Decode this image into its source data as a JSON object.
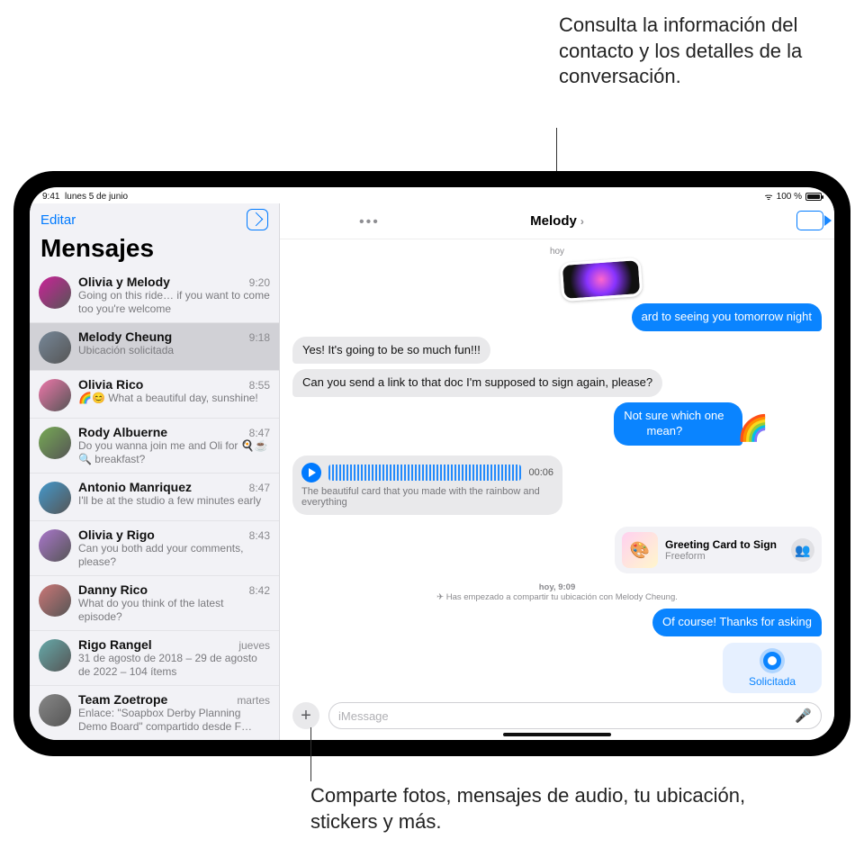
{
  "callouts": {
    "top": "Consulta la información del contacto y los detalles de la conversación.",
    "bottom": "Comparte fotos, mensajes de audio, tu ubicación, stickers y más."
  },
  "status": {
    "time": "9:41",
    "date": "lunes 5 de junio",
    "battery": "100 %",
    "battery_icon_label": "battery"
  },
  "sidebar": {
    "edit": "Editar",
    "title": "Mensajes",
    "conversations": [
      {
        "name": "Olivia y Melody",
        "time": "9:20",
        "preview": "Going on this ride… if you want to come too you're welcome"
      },
      {
        "name": "Melody Cheung",
        "time": "9:18",
        "preview": "Ubicación solicitada",
        "selected": true
      },
      {
        "name": "Olivia Rico",
        "time": "8:55",
        "preview": "🌈😊 What a beautiful day, sunshine!"
      },
      {
        "name": "Rody Albuerne",
        "time": "8:47",
        "preview": "Do you wanna join me and Oli for 🍳☕🔍 breakfast?"
      },
      {
        "name": "Antonio Manriquez",
        "time": "8:47",
        "preview": "I'll be at the studio a few minutes early"
      },
      {
        "name": "Olivia y Rigo",
        "time": "8:43",
        "preview": "Can you both add your comments, please?"
      },
      {
        "name": "Danny Rico",
        "time": "8:42",
        "preview": "What do you think of the latest episode?"
      },
      {
        "name": "Rigo Rangel",
        "time": "jueves",
        "preview": "31 de agosto de 2018 – 29 de agosto de 2022 – 104 ítems"
      },
      {
        "name": "Team Zoetrope",
        "time": "martes",
        "preview": "Enlace: \"Soapbox Derby Planning Demo Board\" compartido desde F…"
      }
    ]
  },
  "chat": {
    "contact": "Melody",
    "day_label": "hoy",
    "msgs": {
      "m1": "ard to seeing you tomorrow night",
      "m2": "Yes! It's going to be so much fun!!!",
      "m3": "Can you send a link to that doc I'm supposed to sign again, please?",
      "m4_a": "Not sure which one",
      "m4_b": "mean?",
      "audio_dur": "00:06",
      "audio_cap": "The beautiful card that you made with the rainbow and everything",
      "link_title": "Greeting Card to Sign",
      "link_sub": "Freeform",
      "sys_time": "hoy, 9:09",
      "sys_text": "Has empezado a compartir tu ubicación con Melody Cheung.",
      "m5": "Of course! Thanks for asking",
      "loc_label": "Solicitada"
    },
    "composer_placeholder": "iMessage"
  }
}
